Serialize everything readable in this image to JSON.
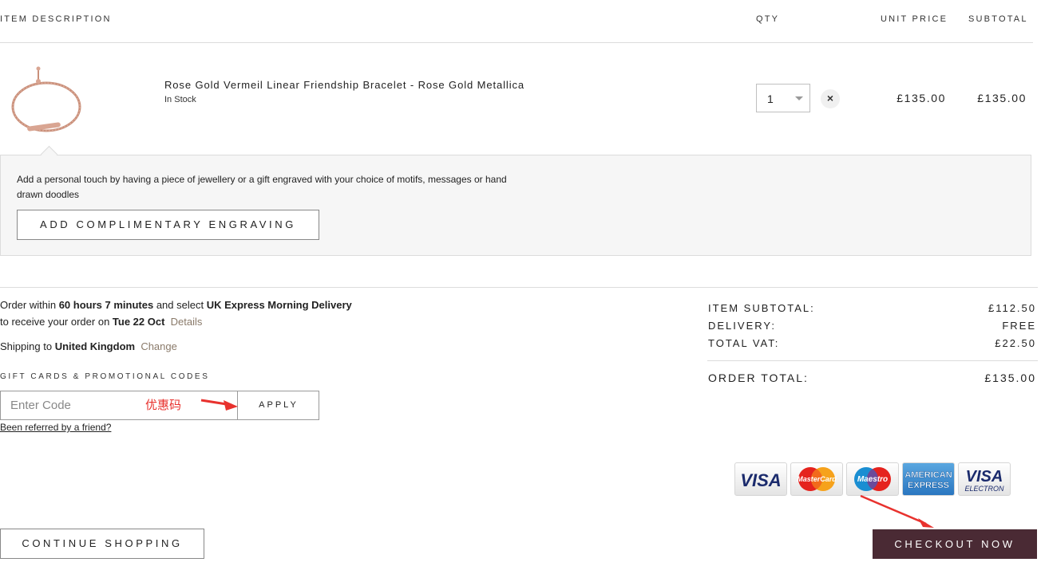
{
  "table_headers": {
    "item_description": "ITEM DESCRIPTION",
    "qty": "QTY",
    "unit_price": "UNIT PRICE",
    "subtotal": "SUBTOTAL"
  },
  "cart_item": {
    "name": "Rose Gold Vermeil Linear Friendship Bracelet - Rose Gold Metallica",
    "stock_status": "In Stock",
    "qty": "1",
    "remove_glyph": "×",
    "unit_price": "£135.00",
    "subtotal": "£135.00",
    "image_icon": "bracelet-image"
  },
  "engraving": {
    "text": "Add a personal touch by having a piece of jewellery or a gift engraved with your choice of motifs, messages or hand drawn doodles",
    "button_label": "ADD COMPLIMENTARY ENGRAVING"
  },
  "delivery": {
    "order_within_prefix": "Order within",
    "time_left": "60 hours 7 minutes",
    "and_select": "and select",
    "service": "UK Express Morning Delivery",
    "receive_prefix": "to receive your order on",
    "date": "Tue 22 Oct",
    "details_link": "Details",
    "shipping_prefix": "Shipping to",
    "country": "United Kingdom",
    "change_link": "Change"
  },
  "promo": {
    "label": "GIFT CARDS & PROMOTIONAL CODES",
    "placeholder": "Enter Code",
    "apply_label": "APPLY",
    "annotation": "优惠码",
    "referred_link": "Been referred by a friend?"
  },
  "summary": {
    "item_subtotal_label": "ITEM SUBTOTAL:",
    "item_subtotal_value": "£112.50",
    "delivery_label": "DELIVERY:",
    "delivery_value": "FREE",
    "vat_label": "TOTAL VAT:",
    "vat_value": "£22.50",
    "order_total_label": "ORDER TOTAL:",
    "order_total_value": "£135.00"
  },
  "payment_cards": [
    {
      "icon": "visa-icon",
      "text": "VISA"
    },
    {
      "icon": "mastercard-icon",
      "text": "MasterCard"
    },
    {
      "icon": "maestro-icon",
      "text": "Maestro"
    },
    {
      "icon": "american-express-icon",
      "text_top": "AMERICAN",
      "text_bottom": "EXPRESS"
    },
    {
      "icon": "visa-electron-icon",
      "text": "VISA",
      "text_bottom": "ELECTRON"
    }
  ],
  "actions": {
    "continue_label": "CONTINUE SHOPPING",
    "checkout_label": "CHECKOUT NOW"
  },
  "colors": {
    "checkout_bg": "#4a2a34",
    "annotation_red": "#e8322e",
    "link_muted": "#8a7a6a",
    "rose_gold": "#c98f7a"
  }
}
